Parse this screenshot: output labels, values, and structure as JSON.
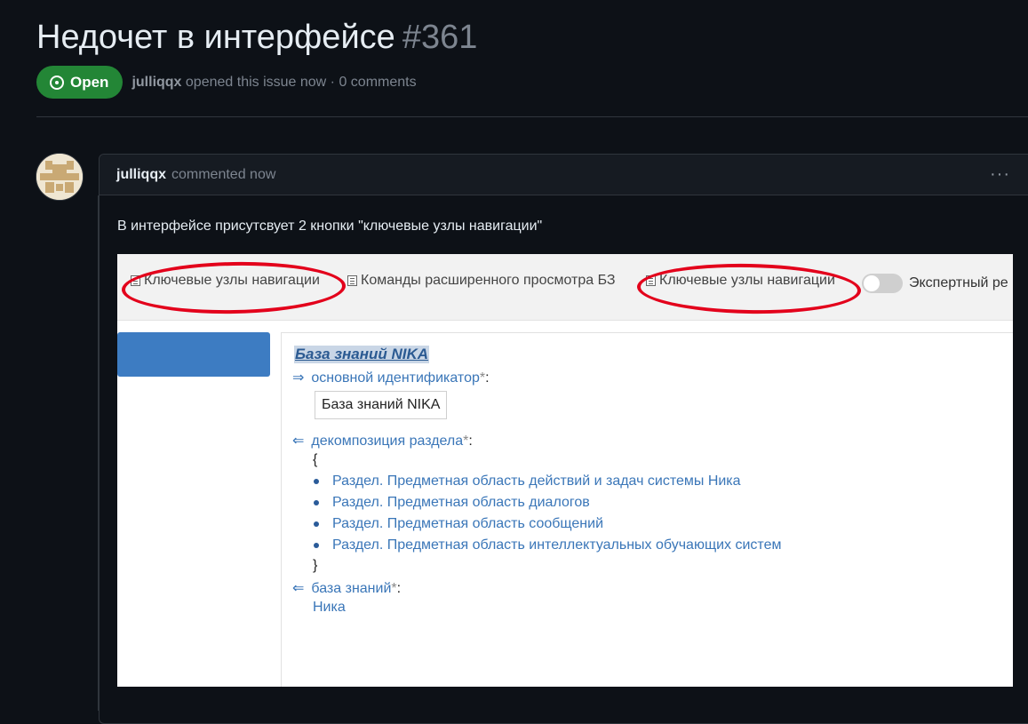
{
  "issue": {
    "title": "Недочет в интерфейсе",
    "number": "#361",
    "status_label": "Open",
    "author": "julliqqx",
    "opened_text": "opened this issue now · 0 comments"
  },
  "comment": {
    "author": "julliqqx",
    "meta": "commented now",
    "menu_icon": "···",
    "body": "В интерфейсе присутсвует 2 кнопки \"ключевые узлы навигации\""
  },
  "screenshot": {
    "toolbar": {
      "btn1": "Ключевые узлы навигации",
      "btn2": "Команды расширенного просмотра БЗ",
      "btn3": "Ключевые узлы навигации",
      "expert": "Экспертный ре"
    },
    "kb_title": "База знаний NIKA",
    "rel1": "основной идентификатор",
    "id_value": "База знаний NIKA",
    "rel2": "декомпозиция раздела",
    "open_brace": "{",
    "sections": [
      "Раздел. Предметная область действий и задач системы Ника",
      "Раздел. Предметная область диалогов",
      "Раздел. Предметная область сообщений",
      "Раздел. Предметная область интеллектуальных обучающих систем"
    ],
    "close_brace": "}",
    "rel3": "база знаний",
    "rel3_value": "Ника",
    "star": "*",
    "colon": ":",
    "arrow_right": "⇒",
    "arrow_left": "⇐"
  },
  "colors": {
    "background": "#0d1117",
    "open_badge": "#238636",
    "link_blue": "#3a76b8",
    "highlight_red": "#e3001b"
  }
}
